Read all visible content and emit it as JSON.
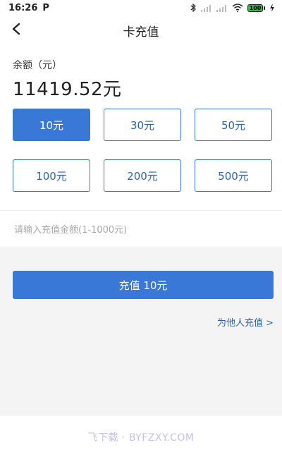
{
  "status_bar": {
    "time": "16:26",
    "notification_icon": "P",
    "battery_level": "100"
  },
  "header": {
    "title": "卡充值",
    "back_icon": "chevron-left-icon"
  },
  "balance": {
    "label": "余额（元）",
    "value": "11419.52元"
  },
  "amount_options": [
    {
      "label": "10元",
      "selected": true
    },
    {
      "label": "30元",
      "selected": false
    },
    {
      "label": "50元",
      "selected": false
    },
    {
      "label": "100元",
      "selected": false
    },
    {
      "label": "200元",
      "selected": false
    },
    {
      "label": "500元",
      "selected": false
    }
  ],
  "custom_amount": {
    "placeholder": "请输入充值金额(1-1000元)",
    "value": ""
  },
  "recharge_button": {
    "label": "充值 10元"
  },
  "other_link": {
    "label": "为他人充值 >"
  },
  "watermark": {
    "text": "飞下载 · BYFZXY.COM"
  },
  "colors": {
    "accent": "#3a78d8",
    "accent_text": "#2f62a8",
    "background": "#ffffff",
    "section_gray": "#f4f4f4"
  }
}
